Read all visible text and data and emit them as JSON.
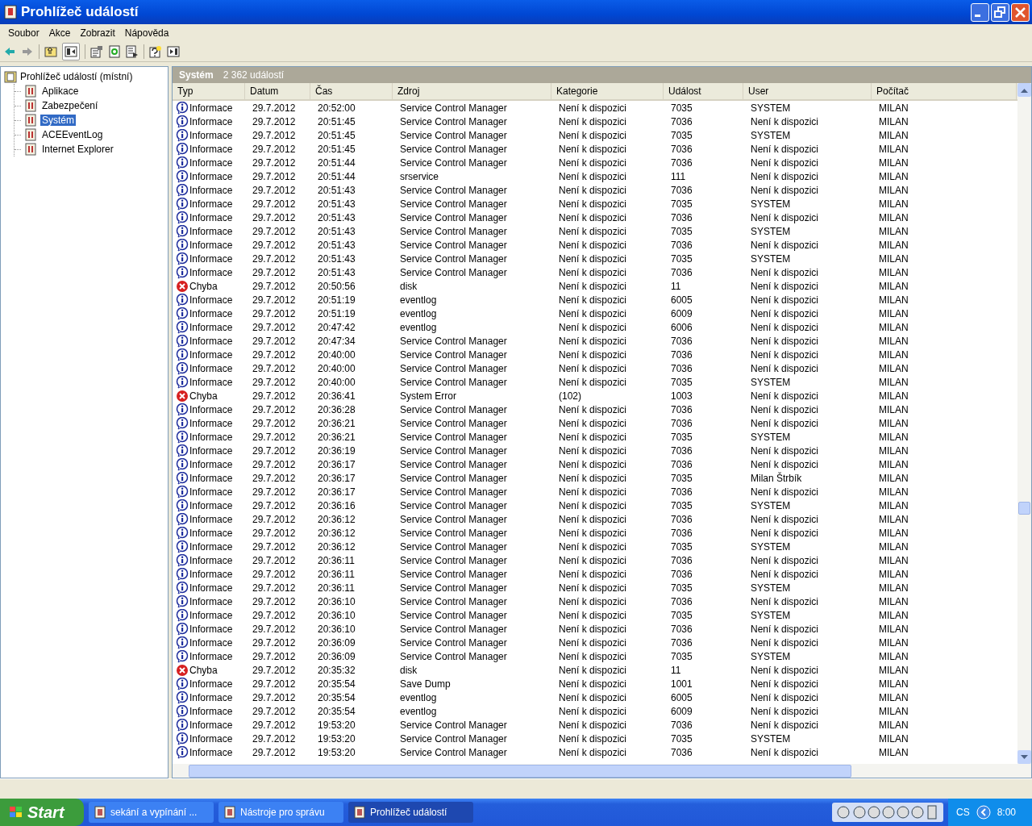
{
  "window": {
    "title": "Prohlížeč událostí"
  },
  "menu": [
    "Soubor",
    "Akce",
    "Zobrazit",
    "Nápověda"
  ],
  "tree": {
    "label": "Prohlížeč událostí (místní)",
    "children": [
      {
        "label": "Aplikace",
        "selected": false
      },
      {
        "label": "Zabezpečení",
        "selected": false
      },
      {
        "label": "Systém",
        "selected": true
      },
      {
        "label": "ACEEventLog",
        "selected": false
      },
      {
        "label": "Internet Explorer",
        "selected": false
      }
    ]
  },
  "panel": {
    "title": "Systém",
    "count": "2 362 událostí"
  },
  "table": {
    "columns": [
      "Typ",
      "Datum",
      "Čas",
      "Zdroj",
      "Kategorie",
      "Událost",
      "User",
      "Počítač"
    ],
    "rows": [
      {
        "kind": "info",
        "cells": [
          "Informace",
          "29.7.2012",
          "20:52:00",
          "Service Control Manager",
          "Není k dispozici",
          "7035",
          "SYSTEM",
          "MILAN"
        ]
      },
      {
        "kind": "info",
        "cells": [
          "Informace",
          "29.7.2012",
          "20:51:45",
          "Service Control Manager",
          "Není k dispozici",
          "7036",
          "Není k dispozici",
          "MILAN"
        ]
      },
      {
        "kind": "info",
        "cells": [
          "Informace",
          "29.7.2012",
          "20:51:45",
          "Service Control Manager",
          "Není k dispozici",
          "7035",
          "SYSTEM",
          "MILAN"
        ]
      },
      {
        "kind": "info",
        "cells": [
          "Informace",
          "29.7.2012",
          "20:51:45",
          "Service Control Manager",
          "Není k dispozici",
          "7036",
          "Není k dispozici",
          "MILAN"
        ]
      },
      {
        "kind": "info",
        "cells": [
          "Informace",
          "29.7.2012",
          "20:51:44",
          "Service Control Manager",
          "Není k dispozici",
          "7036",
          "Není k dispozici",
          "MILAN"
        ]
      },
      {
        "kind": "info",
        "cells": [
          "Informace",
          "29.7.2012",
          "20:51:44",
          "srservice",
          "Není k dispozici",
          "111",
          "Není k dispozici",
          "MILAN"
        ]
      },
      {
        "kind": "info",
        "cells": [
          "Informace",
          "29.7.2012",
          "20:51:43",
          "Service Control Manager",
          "Není k dispozici",
          "7036",
          "Není k dispozici",
          "MILAN"
        ]
      },
      {
        "kind": "info",
        "cells": [
          "Informace",
          "29.7.2012",
          "20:51:43",
          "Service Control Manager",
          "Není k dispozici",
          "7035",
          "SYSTEM",
          "MILAN"
        ]
      },
      {
        "kind": "info",
        "cells": [
          "Informace",
          "29.7.2012",
          "20:51:43",
          "Service Control Manager",
          "Není k dispozici",
          "7036",
          "Není k dispozici",
          "MILAN"
        ]
      },
      {
        "kind": "info",
        "cells": [
          "Informace",
          "29.7.2012",
          "20:51:43",
          "Service Control Manager",
          "Není k dispozici",
          "7035",
          "SYSTEM",
          "MILAN"
        ]
      },
      {
        "kind": "info",
        "cells": [
          "Informace",
          "29.7.2012",
          "20:51:43",
          "Service Control Manager",
          "Není k dispozici",
          "7036",
          "Není k dispozici",
          "MILAN"
        ]
      },
      {
        "kind": "info",
        "cells": [
          "Informace",
          "29.7.2012",
          "20:51:43",
          "Service Control Manager",
          "Není k dispozici",
          "7035",
          "SYSTEM",
          "MILAN"
        ]
      },
      {
        "kind": "info",
        "cells": [
          "Informace",
          "29.7.2012",
          "20:51:43",
          "Service Control Manager",
          "Není k dispozici",
          "7036",
          "Není k dispozici",
          "MILAN"
        ]
      },
      {
        "kind": "error",
        "cells": [
          "Chyba",
          "29.7.2012",
          "20:50:56",
          "disk",
          "Není k dispozici",
          "11",
          "Není k dispozici",
          "MILAN"
        ]
      },
      {
        "kind": "info",
        "cells": [
          "Informace",
          "29.7.2012",
          "20:51:19",
          "eventlog",
          "Není k dispozici",
          "6005",
          "Není k dispozici",
          "MILAN"
        ]
      },
      {
        "kind": "info",
        "cells": [
          "Informace",
          "29.7.2012",
          "20:51:19",
          "eventlog",
          "Není k dispozici",
          "6009",
          "Není k dispozici",
          "MILAN"
        ]
      },
      {
        "kind": "info",
        "cells": [
          "Informace",
          "29.7.2012",
          "20:47:42",
          "eventlog",
          "Není k dispozici",
          "6006",
          "Není k dispozici",
          "MILAN"
        ]
      },
      {
        "kind": "info",
        "cells": [
          "Informace",
          "29.7.2012",
          "20:47:34",
          "Service Control Manager",
          "Není k dispozici",
          "7036",
          "Není k dispozici",
          "MILAN"
        ]
      },
      {
        "kind": "info",
        "cells": [
          "Informace",
          "29.7.2012",
          "20:40:00",
          "Service Control Manager",
          "Není k dispozici",
          "7036",
          "Není k dispozici",
          "MILAN"
        ]
      },
      {
        "kind": "info",
        "cells": [
          "Informace",
          "29.7.2012",
          "20:40:00",
          "Service Control Manager",
          "Není k dispozici",
          "7036",
          "Není k dispozici",
          "MILAN"
        ]
      },
      {
        "kind": "info",
        "cells": [
          "Informace",
          "29.7.2012",
          "20:40:00",
          "Service Control Manager",
          "Není k dispozici",
          "7035",
          "SYSTEM",
          "MILAN"
        ]
      },
      {
        "kind": "error",
        "cells": [
          "Chyba",
          "29.7.2012",
          "20:36:41",
          "System Error",
          "(102)",
          "1003",
          "Není k dispozici",
          "MILAN"
        ]
      },
      {
        "kind": "info",
        "cells": [
          "Informace",
          "29.7.2012",
          "20:36:28",
          "Service Control Manager",
          "Není k dispozici",
          "7036",
          "Není k dispozici",
          "MILAN"
        ]
      },
      {
        "kind": "info",
        "cells": [
          "Informace",
          "29.7.2012",
          "20:36:21",
          "Service Control Manager",
          "Není k dispozici",
          "7036",
          "Není k dispozici",
          "MILAN"
        ]
      },
      {
        "kind": "info",
        "cells": [
          "Informace",
          "29.7.2012",
          "20:36:21",
          "Service Control Manager",
          "Není k dispozici",
          "7035",
          "SYSTEM",
          "MILAN"
        ]
      },
      {
        "kind": "info",
        "cells": [
          "Informace",
          "29.7.2012",
          "20:36:19",
          "Service Control Manager",
          "Není k dispozici",
          "7036",
          "Není k dispozici",
          "MILAN"
        ]
      },
      {
        "kind": "info",
        "cells": [
          "Informace",
          "29.7.2012",
          "20:36:17",
          "Service Control Manager",
          "Není k dispozici",
          "7036",
          "Není k dispozici",
          "MILAN"
        ]
      },
      {
        "kind": "info",
        "cells": [
          "Informace",
          "29.7.2012",
          "20:36:17",
          "Service Control Manager",
          "Není k dispozici",
          "7035",
          "Milan Štrbík",
          "MILAN"
        ]
      },
      {
        "kind": "info",
        "cells": [
          "Informace",
          "29.7.2012",
          "20:36:17",
          "Service Control Manager",
          "Není k dispozici",
          "7036",
          "Není k dispozici",
          "MILAN"
        ]
      },
      {
        "kind": "info",
        "cells": [
          "Informace",
          "29.7.2012",
          "20:36:16",
          "Service Control Manager",
          "Není k dispozici",
          "7035",
          "SYSTEM",
          "MILAN"
        ]
      },
      {
        "kind": "info",
        "cells": [
          "Informace",
          "29.7.2012",
          "20:36:12",
          "Service Control Manager",
          "Není k dispozici",
          "7036",
          "Není k dispozici",
          "MILAN"
        ]
      },
      {
        "kind": "info",
        "cells": [
          "Informace",
          "29.7.2012",
          "20:36:12",
          "Service Control Manager",
          "Není k dispozici",
          "7036",
          "Není k dispozici",
          "MILAN"
        ]
      },
      {
        "kind": "info",
        "cells": [
          "Informace",
          "29.7.2012",
          "20:36:12",
          "Service Control Manager",
          "Není k dispozici",
          "7035",
          "SYSTEM",
          "MILAN"
        ]
      },
      {
        "kind": "info",
        "cells": [
          "Informace",
          "29.7.2012",
          "20:36:11",
          "Service Control Manager",
          "Není k dispozici",
          "7036",
          "Není k dispozici",
          "MILAN"
        ]
      },
      {
        "kind": "info",
        "cells": [
          "Informace",
          "29.7.2012",
          "20:36:11",
          "Service Control Manager",
          "Není k dispozici",
          "7036",
          "Není k dispozici",
          "MILAN"
        ]
      },
      {
        "kind": "info",
        "cells": [
          "Informace",
          "29.7.2012",
          "20:36:11",
          "Service Control Manager",
          "Není k dispozici",
          "7035",
          "SYSTEM",
          "MILAN"
        ]
      },
      {
        "kind": "info",
        "cells": [
          "Informace",
          "29.7.2012",
          "20:36:10",
          "Service Control Manager",
          "Není k dispozici",
          "7036",
          "Není k dispozici",
          "MILAN"
        ]
      },
      {
        "kind": "info",
        "cells": [
          "Informace",
          "29.7.2012",
          "20:36:10",
          "Service Control Manager",
          "Není k dispozici",
          "7035",
          "SYSTEM",
          "MILAN"
        ]
      },
      {
        "kind": "info",
        "cells": [
          "Informace",
          "29.7.2012",
          "20:36:10",
          "Service Control Manager",
          "Není k dispozici",
          "7036",
          "Není k dispozici",
          "MILAN"
        ]
      },
      {
        "kind": "info",
        "cells": [
          "Informace",
          "29.7.2012",
          "20:36:09",
          "Service Control Manager",
          "Není k dispozici",
          "7036",
          "Není k dispozici",
          "MILAN"
        ]
      },
      {
        "kind": "info",
        "cells": [
          "Informace",
          "29.7.2012",
          "20:36:09",
          "Service Control Manager",
          "Není k dispozici",
          "7035",
          "SYSTEM",
          "MILAN"
        ]
      },
      {
        "kind": "error",
        "cells": [
          "Chyba",
          "29.7.2012",
          "20:35:32",
          "disk",
          "Není k dispozici",
          "11",
          "Není k dispozici",
          "MILAN"
        ]
      },
      {
        "kind": "info",
        "cells": [
          "Informace",
          "29.7.2012",
          "20:35:54",
          "Save Dump",
          "Není k dispozici",
          "1001",
          "Není k dispozici",
          "MILAN"
        ]
      },
      {
        "kind": "info",
        "cells": [
          "Informace",
          "29.7.2012",
          "20:35:54",
          "eventlog",
          "Není k dispozici",
          "6005",
          "Není k dispozici",
          "MILAN"
        ]
      },
      {
        "kind": "info",
        "cells": [
          "Informace",
          "29.7.2012",
          "20:35:54",
          "eventlog",
          "Není k dispozici",
          "6009",
          "Není k dispozici",
          "MILAN"
        ]
      },
      {
        "kind": "info",
        "cells": [
          "Informace",
          "29.7.2012",
          "19:53:20",
          "Service Control Manager",
          "Není k dispozici",
          "7036",
          "Není k dispozici",
          "MILAN"
        ]
      },
      {
        "kind": "info",
        "cells": [
          "Informace",
          "29.7.2012",
          "19:53:20",
          "Service Control Manager",
          "Není k dispozici",
          "7035",
          "SYSTEM",
          "MILAN"
        ]
      },
      {
        "kind": "info",
        "cells": [
          "Informace",
          "29.7.2012",
          "19:53:20",
          "Service Control Manager",
          "Není k dispozici",
          "7036",
          "Není k dispozici",
          "MILAN"
        ]
      }
    ]
  },
  "taskbar": {
    "start": "Start",
    "tasks": [
      {
        "label": "sekání a vypínání ...",
        "selected": false
      },
      {
        "label": "Nástroje pro správu",
        "selected": false
      },
      {
        "label": "Prohlížeč událostí",
        "selected": true
      }
    ],
    "language": "CS",
    "clock": "8:00"
  }
}
